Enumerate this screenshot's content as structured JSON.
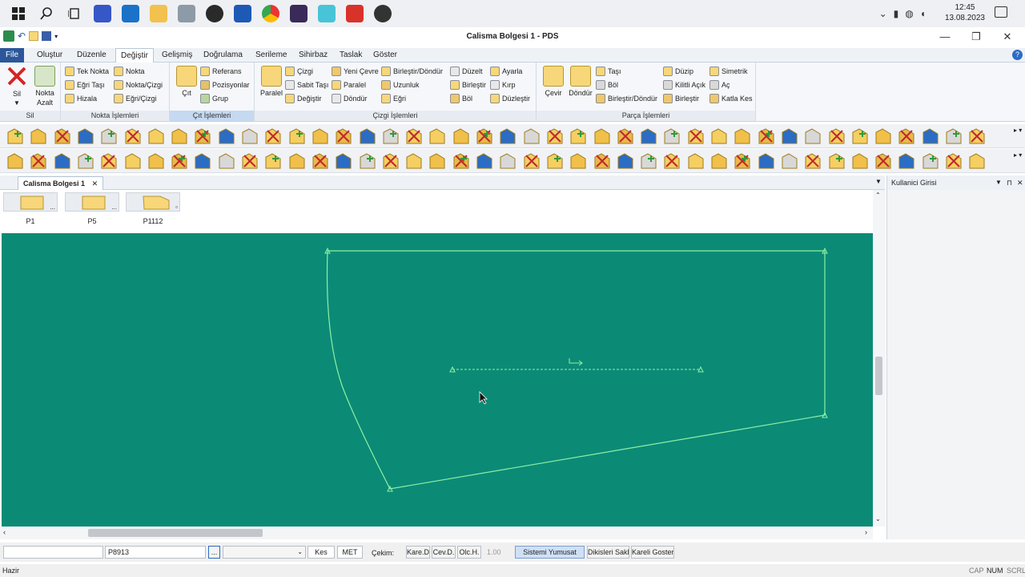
{
  "app": {
    "window_title": "Calisma Bolgesi 1 - PDS",
    "min_glyph": "—",
    "max_glyph": "❐",
    "close_glyph": "✕"
  },
  "taskbar": {
    "time": "12:45",
    "date": "13.08.2023"
  },
  "menu": {
    "file": "File",
    "items": [
      "Oluştur",
      "Düzenle",
      "Değiştir",
      "Gelişmiş",
      "Doğrulama",
      "Serileme",
      "Sihirbaz",
      "Taslak",
      "Göster"
    ],
    "active": "Değiştir"
  },
  "ribbon": {
    "sil": {
      "big_label": "Sil",
      "big2_label_1": "Nokta",
      "big2_label_2": "Azalt",
      "group": "Sil"
    },
    "nokta": {
      "items": [
        "Tek Nokta",
        "Nokta",
        "Eğri Taşı",
        "Nokta/Çizgi",
        "Hizala",
        "Eğri/Çizgi"
      ],
      "group": "Nokta İşlemleri"
    },
    "cit": {
      "big_label": "Çıt",
      "items": [
        "Referans",
        "Pozisyonlar",
        "Grup"
      ],
      "group": "Çıt İşlemleri"
    },
    "cizgi": {
      "big_label": "Paralel",
      "items": [
        "Çizgi",
        "Sabit Taşı",
        "Değiştir",
        "Yeni Çevre",
        "Paralel",
        "Döndür",
        "Birleştir/Döndür",
        "Uzunluk",
        "Eğri",
        "Düzelt",
        "Birleştir",
        "Böl",
        "Ayarla",
        "Kırp",
        "Düzleştir"
      ],
      "group": "Çizgi İşlemleri"
    },
    "parca": {
      "big1": "Çevir",
      "big2": "Döndür",
      "items": [
        "Taşı",
        "Böl",
        "Birleştir/Döndür",
        "Düzip",
        "Kilitli Açık",
        "Birleştir",
        "Simetrik",
        "Aç",
        "Katla Kes"
      ],
      "group": "Parça İşlemleri"
    }
  },
  "doc_tab": {
    "label": "Calisma Bolgesi 1",
    "close": "✕"
  },
  "pieces": [
    {
      "label": "P1",
      "suffix": "..."
    },
    {
      "label": "P5",
      "suffix": "..."
    },
    {
      "label": "P1112",
      "suffix": "▫"
    }
  ],
  "right_panel": {
    "title": "Kullanici Girisi"
  },
  "commandbar": {
    "field1": "",
    "field2": "P8913",
    "browse": "...",
    "field3": "",
    "kes": "Kes",
    "met": "MET",
    "cekim_label": "Çekim:",
    "kare_d": "Kare.D",
    "cev_d": "Cev.D.",
    "olc_h": "Olc.H.",
    "scale": "1.00",
    "sistemi_yumusat": "Sistemi Yumusat",
    "dikisleri_sakla": "Dikisleri Sakla",
    "kareli_goster": "Kareli Goster"
  },
  "status": {
    "left": "Hazir",
    "cap": "CAP",
    "num": "NUM",
    "scrl": "SCRL"
  },
  "colors": {
    "canvas": "#0b8b76",
    "piece_line": "#8ff0a4",
    "accent": "#2b579a"
  }
}
